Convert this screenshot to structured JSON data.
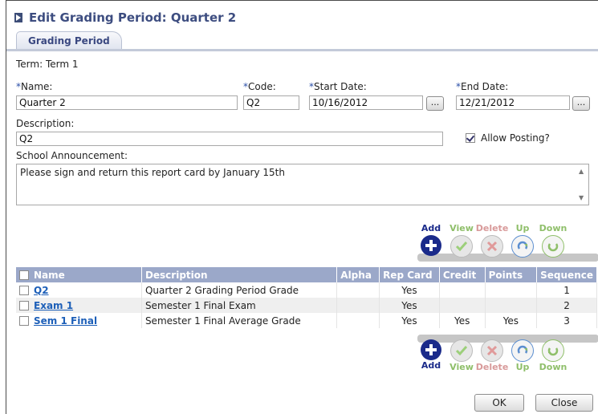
{
  "window": {
    "title": "Edit Grading Period: Quarter 2"
  },
  "tabs": [
    {
      "label": "Grading Period"
    }
  ],
  "term": {
    "label": "Term:",
    "value": "Term 1"
  },
  "fields": {
    "name": {
      "required_mark": "*",
      "label": "Name:",
      "value": "Quarter 2"
    },
    "code": {
      "required_mark": "*",
      "label": "Code:",
      "value": "Q2"
    },
    "start_date": {
      "required_mark": "*",
      "label": "Start Date:",
      "value": "10/16/2012",
      "picker_label": "..."
    },
    "end_date": {
      "required_mark": "*",
      "label": "End Date:",
      "value": "12/21/2012",
      "picker_label": "..."
    },
    "description": {
      "label": "Description:",
      "value": "Q2"
    },
    "allow_posting": {
      "label": "Allow Posting?",
      "checked": true
    },
    "school_announcement": {
      "label": "School Announcement:",
      "value": "Please sign and return this report card by January 15th"
    }
  },
  "toolbar": {
    "add": "Add",
    "view": "View",
    "delete": "Delete",
    "up": "Up",
    "down": "Down"
  },
  "grid": {
    "columns": [
      "Name",
      "Description",
      "Alpha",
      "Rep Card",
      "Credit",
      "Points",
      "Sequence"
    ],
    "rows": [
      {
        "name": "Q2",
        "description": "Quarter 2 Grading Period Grade",
        "alpha": "",
        "rep_card": "Yes",
        "credit": "",
        "points": "",
        "sequence": "1"
      },
      {
        "name": "Exam 1",
        "description": "Semester 1 Final Exam",
        "alpha": "",
        "rep_card": "Yes",
        "credit": "",
        "points": "",
        "sequence": "2"
      },
      {
        "name": "Sem 1 Final",
        "description": "Semester 1 Final Average Grade",
        "alpha": "",
        "rep_card": "Yes",
        "credit": "Yes",
        "points": "Yes",
        "sequence": "3"
      }
    ]
  },
  "buttons": {
    "ok": "OK",
    "close": "Close"
  },
  "colors": {
    "title": "#3d4d80",
    "grid_header": "#9ba8c9",
    "link": "#1d5fb8",
    "add": "#1a2a8a"
  }
}
